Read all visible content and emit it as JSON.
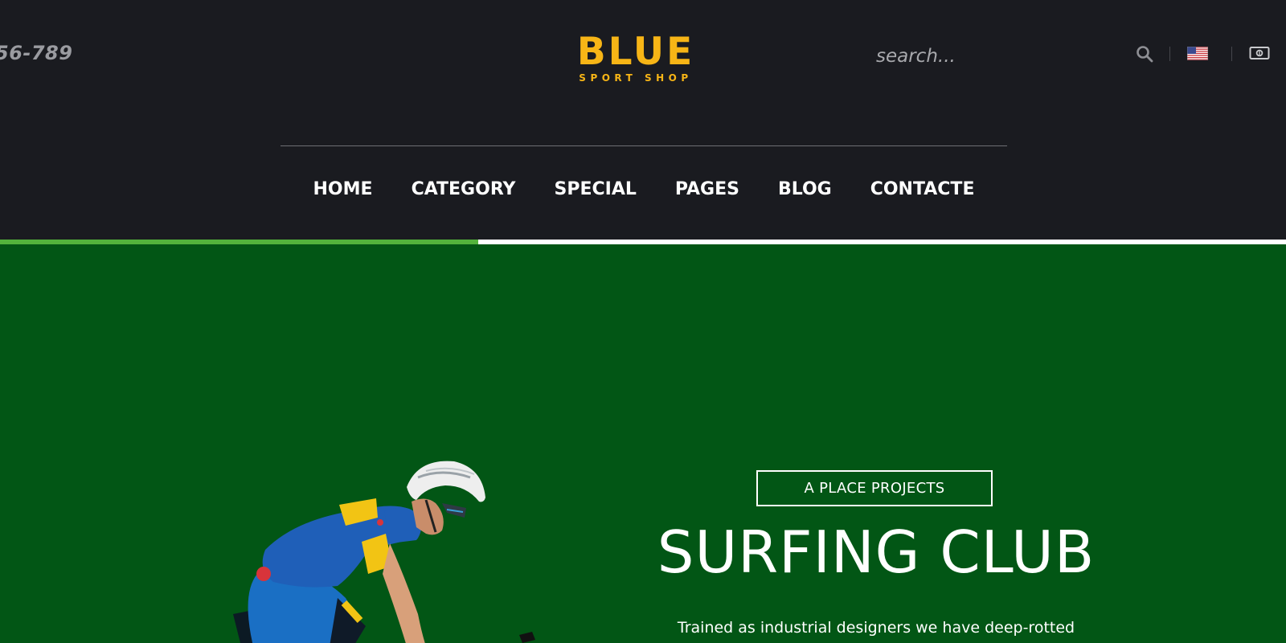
{
  "header": {
    "phone": "56-789",
    "logo": {
      "main": "BLUE",
      "sub": "SPORT SHOP"
    },
    "search": {
      "placeholder": "search..."
    },
    "icons": [
      "search-icon",
      "us-flag-icon",
      "currency-icon"
    ]
  },
  "nav": {
    "items": [
      {
        "label": "HOME"
      },
      {
        "label": "CATEGORY"
      },
      {
        "label": "SPECIAL"
      },
      {
        "label": "PAGES"
      },
      {
        "label": "BLOG"
      },
      {
        "label": "CONTACTE"
      }
    ]
  },
  "slider": {
    "progress": 0.372
  },
  "hero": {
    "tag": "A PLACE PROJECTS",
    "title": "SURFING CLUB",
    "text": "Trained as industrial designers we have deep-rotted"
  },
  "colors": {
    "header_bg": "#1a1b20",
    "hero_bg": "#025615",
    "brand": "#f7b516",
    "progress_fill": "#53b33c",
    "progress_track": "#ffffff"
  }
}
